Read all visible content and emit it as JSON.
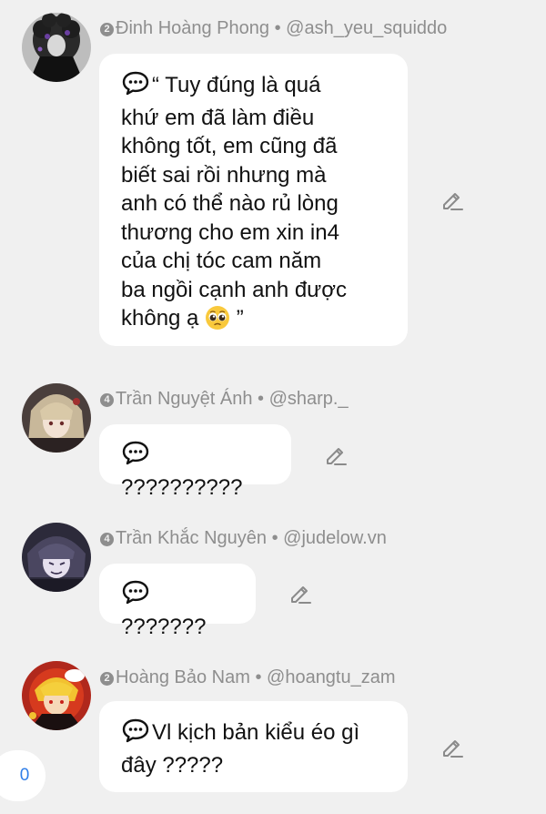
{
  "comments": [
    {
      "level": "2",
      "name": "Đinh Hoàng Phong",
      "separator": "•",
      "handle": "@ash_yeu_squiddo",
      "text": "“ Tuy đúng là quá\nkhứ em đã làm điều\nkhông tốt, em cũng đã\nbiết sai rồi nhưng mà\nanh có thể nào rủ lòng\nthương cho em xin in4\ncủa chị tóc cam năm\nba ngồi cạnh anh được\nkhông ạ",
      "emoji": "pleading-face",
      "text_end": " ”"
    },
    {
      "level": "4",
      "name": "Trần Nguyệt Ánh",
      "separator": "•",
      "handle": "@sharp._",
      "text": "??????????"
    },
    {
      "level": "4",
      "name": "Trần Khắc Nguyên",
      "separator": "•",
      "handle": "@judelow.vn",
      "text": "???????"
    },
    {
      "level": "2",
      "name": "Hoàng Bảo Nam",
      "separator": "•",
      "handle": "@hoangtu_zam",
      "text": "Vl kịch bản kiểu éo gì\nđây ?????"
    }
  ],
  "counter": "0",
  "icons": {
    "speech": "speech-bubble-icon",
    "edit": "pencil-icon"
  },
  "colors": {
    "background": "#f0f0f0",
    "bubble": "#ffffff",
    "meta_text": "#8e8e8e",
    "counter_text": "#2f7ee8"
  }
}
